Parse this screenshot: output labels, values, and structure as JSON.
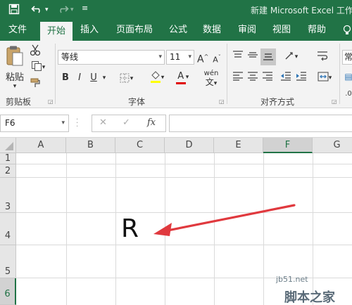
{
  "titlebar": {
    "title": "新建 Microsoft Excel 工作",
    "save_icon": "save-icon",
    "undo_icon": "undo-icon",
    "redo_icon": "redo-icon"
  },
  "tabs": [
    "文件",
    "开始",
    "插入",
    "页面布局",
    "公式",
    "数据",
    "审阅",
    "视图",
    "帮助"
  ],
  "active_tab": "开始",
  "ribbon": {
    "clipboard": {
      "paste_label": "粘贴",
      "group_label": "剪贴板"
    },
    "font": {
      "font_name": "等线",
      "font_size": "11",
      "grow_label": "A",
      "shrink_label": "A",
      "bold": "B",
      "italic": "I",
      "underline": "U",
      "font_color_label": "A",
      "phonetic_label": "wén",
      "group_label": "字体"
    },
    "alignment": {
      "group_label": "对齐方式"
    },
    "number": {
      "format_label": "常"
    }
  },
  "formula_bar": {
    "name_box": "F6",
    "cancel": "✕",
    "enter": "✓",
    "fx": "fx",
    "formula": ""
  },
  "grid": {
    "columns": [
      "A",
      "B",
      "C",
      "D",
      "E",
      "F",
      "G"
    ],
    "rows": [
      "1",
      "2",
      "3",
      "4",
      "5",
      "6"
    ],
    "selected_column": "F",
    "selected_row": "6",
    "cell_c4_value": "R"
  },
  "watermark": {
    "line1": "jb51.net",
    "line2": "脚本之家"
  },
  "colors": {
    "accent": "#217346",
    "arrow": "#e0393e"
  }
}
